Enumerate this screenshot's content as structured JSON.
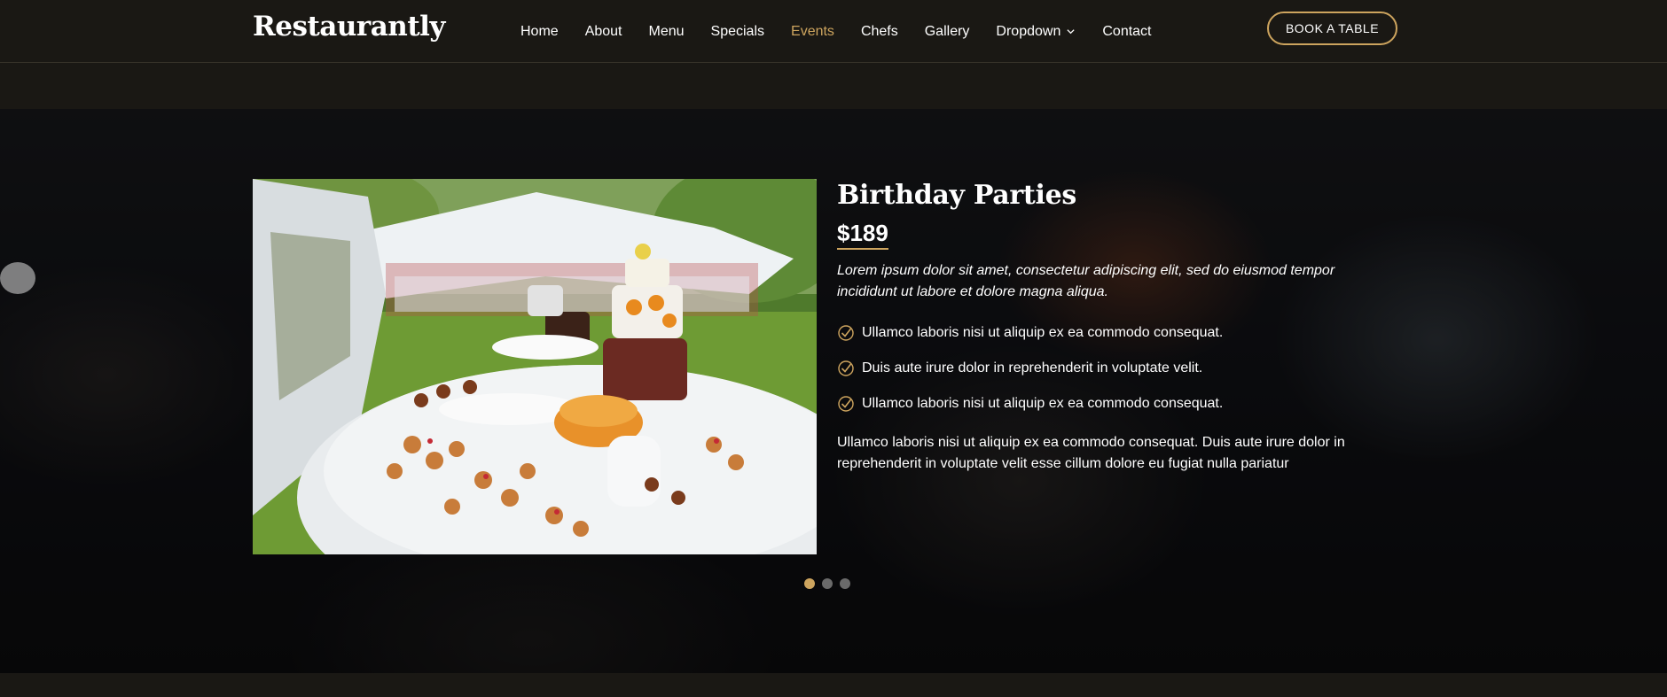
{
  "brand": {
    "name": "Restaurantly"
  },
  "nav": {
    "items": [
      {
        "label": "Home",
        "active": false
      },
      {
        "label": "About",
        "active": false
      },
      {
        "label": "Menu",
        "active": false
      },
      {
        "label": "Specials",
        "active": false
      },
      {
        "label": "Events",
        "active": true
      },
      {
        "label": "Chefs",
        "active": false
      },
      {
        "label": "Gallery",
        "active": false
      },
      {
        "label": "Dropdown",
        "active": false,
        "has_dropdown": true
      },
      {
        "label": "Contact",
        "active": false
      }
    ],
    "book_label": "BOOK A TABLE"
  },
  "event": {
    "title": "Birthday Parties",
    "price": "$189",
    "lead": "Lorem ipsum dolor sit amet, consectetur adipiscing elit, sed do eiusmod tempor incididunt ut labore et dolore magna aliqua.",
    "checklist": [
      "Ullamco laboris nisi ut aliquip ex ea commodo consequat.",
      "Duis aute irure dolor in reprehenderit in voluptate velit.",
      "Ullamco laboris nisi ut aliquip ex ea commodo consequat."
    ],
    "closing": "Ullamco laboris nisi ut aliquip ex ea commodo consequat. Duis aute irure dolor in reprehenderit in voluptate velit esse cillum dolore eu fugiat nulla pariatur"
  },
  "slider": {
    "count": 3,
    "active_index": 0
  },
  "colors": {
    "accent": "#cda45e",
    "header_bg": "#1a1814",
    "text": "#ffffff"
  },
  "icons": {
    "check": "check-circle-icon",
    "chevron": "chevron-down-icon"
  }
}
